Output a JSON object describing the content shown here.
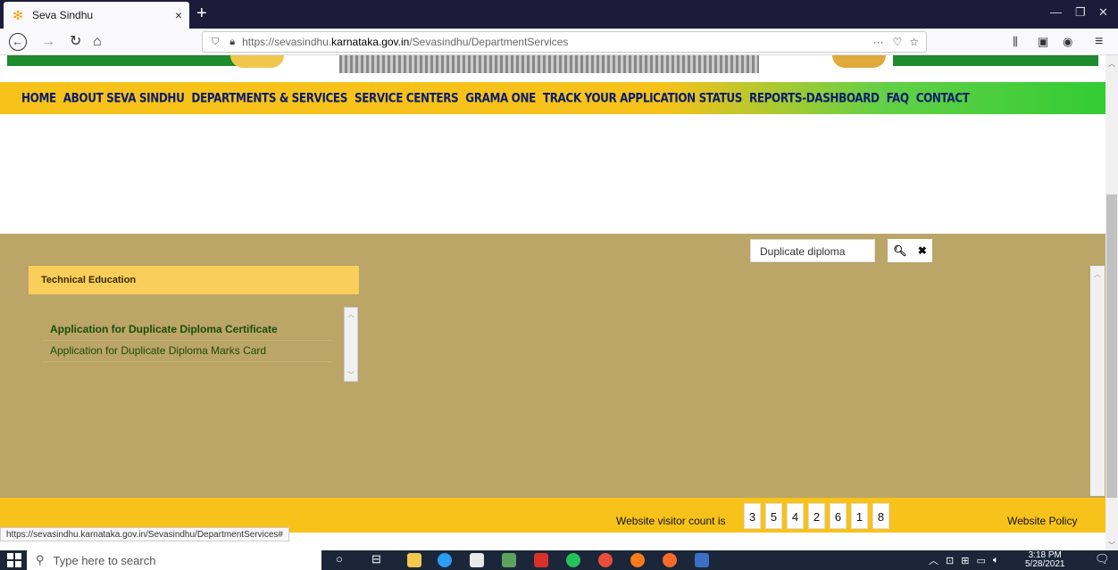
{
  "browser": {
    "tab_title": "Seva Sindhu",
    "tab_close": "×",
    "new_tab": "+",
    "url_prefix": "https://sevasindhu.",
    "url_domain": "karnataka.gov.in",
    "url_suffix": "/Sevasindhu/DepartmentServices",
    "page_actions": "···",
    "status_url": "https://sevasindhu.karnataka.gov.in/Sevasindhu/DepartmentServices#"
  },
  "nav": {
    "items": [
      "HOME",
      "ABOUT SEVA SINDHU",
      "DEPARTMENTS & SERVICES",
      "SERVICE CENTERS",
      "GRAMA ONE",
      "TRACK YOUR APPLICATION STATUS",
      "REPORTS-DASHBOARD",
      "FAQ",
      "CONTACT"
    ]
  },
  "search": {
    "value": "Duplicate diploma"
  },
  "department": {
    "name": "Technical Education",
    "services": [
      "Application for Duplicate Diploma Certificate",
      "Application for Duplicate Diploma Marks Card"
    ]
  },
  "footer": {
    "visitor_label": "Website visitor count is",
    "digits": [
      "3",
      "5",
      "4",
      "2",
      "6",
      "1",
      "8"
    ],
    "policy": "Website Policy"
  },
  "taskbar": {
    "search_placeholder": "Type here to search",
    "time": "3:18 PM",
    "date": "5/28/2021"
  },
  "colors": {
    "content_bg": "#bba567",
    "nav_yellow": "#f7c21a",
    "nav_text": "#0a1d6b",
    "dept_header": "#f9ce5a",
    "service_text": "#1b4d0a"
  }
}
